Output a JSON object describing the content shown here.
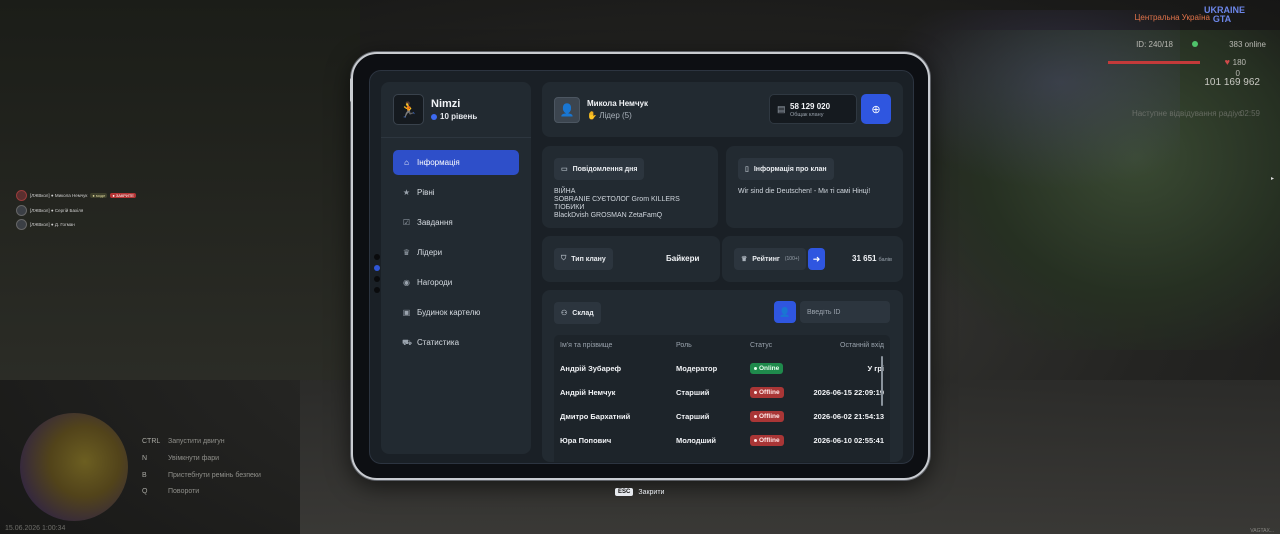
{
  "hud": {
    "server": "Центральна Україна",
    "logo": "UKRAINE GTA",
    "id_label": "ID: 240/18",
    "online": "383 online",
    "hp": "180",
    "armor": "0",
    "money": "101 169 962",
    "warning": "Наступне відвідування радіус",
    "timer": "02:59",
    "date": "15.06.2026 1:00:34",
    "version": "VAGTAX..."
  },
  "chat": [
    {
      "text": "[ЛЖВкол] ● Микола Немчук",
      "badge1": "● моде",
      "badge2": "● ЗАКРИТЕ"
    },
    {
      "text": "[ЛЖВкол] ● Сергій Бахіля",
      "badge1": "",
      "badge2": ""
    },
    {
      "text": "[ЛЖВкол] ● Д. Гогман",
      "badge1": "",
      "badge2": ""
    }
  ],
  "hints": [
    {
      "key": "CTRL",
      "label": "Запустити двигун"
    },
    {
      "key": "N",
      "label": "Увімкнути фари"
    },
    {
      "key": "B",
      "label": "Пристебнути ремінь безпеки"
    },
    {
      "key": "Q",
      "label": "Повороти"
    }
  ],
  "profile": {
    "name": "Nimzi",
    "level": "10 рівень"
  },
  "nav": [
    {
      "label": "Інформація",
      "icon": "home-icon",
      "glyph": "⌂",
      "active": true
    },
    {
      "label": "Рівні",
      "icon": "star-icon",
      "glyph": "★",
      "active": false
    },
    {
      "label": "Завдання",
      "icon": "checklist-icon",
      "glyph": "☑",
      "active": false
    },
    {
      "label": "Лідери",
      "icon": "crown-icon",
      "glyph": "♛",
      "active": false
    },
    {
      "label": "Нагороди",
      "icon": "medal-icon",
      "glyph": "◉",
      "active": false
    },
    {
      "label": "Будинок картелю",
      "icon": "house-icon",
      "glyph": "▣",
      "active": false
    },
    {
      "label": "Статистика",
      "icon": "car-icon",
      "glyph": "⛟",
      "active": false
    }
  ],
  "header": {
    "leader_name": "Микола Немчук",
    "leader_role": "Лідер (5)",
    "bank_value": "58 129 020",
    "bank_label": "Общак клану"
  },
  "motd": {
    "title": "Повідомлення дня",
    "text": "ВІЙНА\nSOBRANIE СУЄТОЛОГ  Grom  KILLERS\nТІОБИКИ\n BlackDvish  GROSMAN ZetaFamQ"
  },
  "clan_info": {
    "title": "Інформація про клан",
    "text": "Wir sind die Deutschen! - Ми ті самі Нінці!"
  },
  "clan_type": {
    "label": "Тип клану",
    "value": "Байкери"
  },
  "rating": {
    "label": "Рейтинг",
    "sub": "(100+)",
    "score": "31 651",
    "unit": "балів"
  },
  "members": {
    "tab_label": "Склад",
    "search_placeholder": "Введіть ID",
    "columns": [
      "Ім'я та прізвище",
      "Роль",
      "Статус",
      "Останній вхід"
    ],
    "rows": [
      {
        "name": "Андрій Зубареф",
        "role": "Модератор",
        "status": "Online",
        "last": "У грі"
      },
      {
        "name": "Андрій Немчук",
        "role": "Старший",
        "status": "Offline",
        "last": "2026-06-15 22:09:19"
      },
      {
        "name": "Дмитро Бархатний",
        "role": "Старший",
        "status": "Offline",
        "last": "2026-06-02 21:54:13"
      },
      {
        "name": "Юра Попович",
        "role": "Молодший",
        "status": "Offline",
        "last": "2026-06-10 02:55:41"
      }
    ]
  },
  "close_hint": {
    "key": "ESC",
    "label": "Закрити"
  },
  "colors": {
    "accent": "#2f56e0",
    "online": "#1f8a4c",
    "offline": "#a93636",
    "panel": "#222a31"
  }
}
